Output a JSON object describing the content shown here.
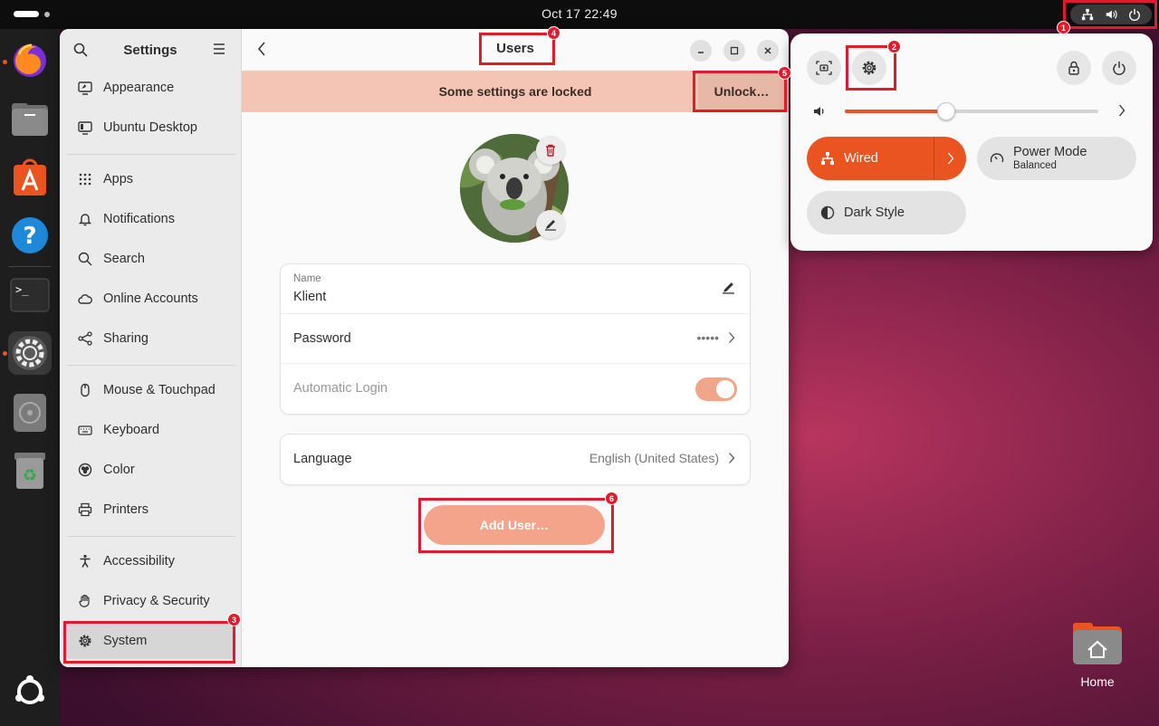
{
  "topbar": {
    "clock": "Oct 17  22:49"
  },
  "dock": {
    "apps": [
      "firefox-icon",
      "files-icon",
      "app-center-icon",
      "help-icon",
      "terminal-icon",
      "settings-icon",
      "disk-icon",
      "trash-icon",
      "show-apps-icon"
    ]
  },
  "sidebar": {
    "title": "Settings",
    "items": [
      {
        "label": "Appearance"
      },
      {
        "label": "Ubuntu Desktop"
      },
      {
        "label": "Apps"
      },
      {
        "label": "Notifications"
      },
      {
        "label": "Search"
      },
      {
        "label": "Online Accounts"
      },
      {
        "label": "Sharing"
      },
      {
        "label": "Mouse & Touchpad"
      },
      {
        "label": "Keyboard"
      },
      {
        "label": "Color"
      },
      {
        "label": "Printers"
      },
      {
        "label": "Accessibility"
      },
      {
        "label": "Privacy & Security"
      },
      {
        "label": "System"
      }
    ]
  },
  "content": {
    "title": "Users",
    "lock_text": "Some settings are locked",
    "unlock_label": "Unlock…",
    "name_label": "Name",
    "name_value": "Klient",
    "password_label": "Password",
    "password_value": "•••••",
    "autologin_label": "Automatic Login",
    "autologin_on": true,
    "language_label": "Language",
    "language_value": "English (United States)",
    "add_user_label": "Add User…"
  },
  "quick_settings": {
    "volume_level": 0.4,
    "wired_label": "Wired",
    "power_mode_label": "Power Mode",
    "power_mode_value": "Balanced",
    "dark_style_label": "Dark Style"
  },
  "desktop": {
    "home_label": "Home"
  },
  "annotations": {
    "b1": "1",
    "b2": "2",
    "b3": "3",
    "b4": "4",
    "b5": "5",
    "b6": "6"
  },
  "colors": {
    "accent": "#e95420",
    "annotation": "#e21b2b"
  }
}
